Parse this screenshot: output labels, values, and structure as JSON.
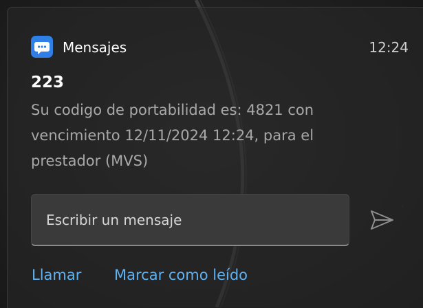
{
  "notification": {
    "app_name": "Mensajes",
    "app_icon": "chat-bubble-icon",
    "time": "12:24",
    "sender": "223",
    "body_lines": [
      "Su codigo de portabilidad es: 4821 con",
      "vencimiento 12/11/2024 12:24, para el",
      "prestador (MVS)"
    ]
  },
  "reply": {
    "placeholder": "Escribir un mensaje",
    "send_icon": "send-icon"
  },
  "actions": {
    "call_label": "Llamar",
    "mark_read_label": "Marcar como leído"
  },
  "colors": {
    "app_icon_bg": "#2f7fe6",
    "link": "#5fb2f2",
    "secondary_text": "#a8a8a8"
  }
}
